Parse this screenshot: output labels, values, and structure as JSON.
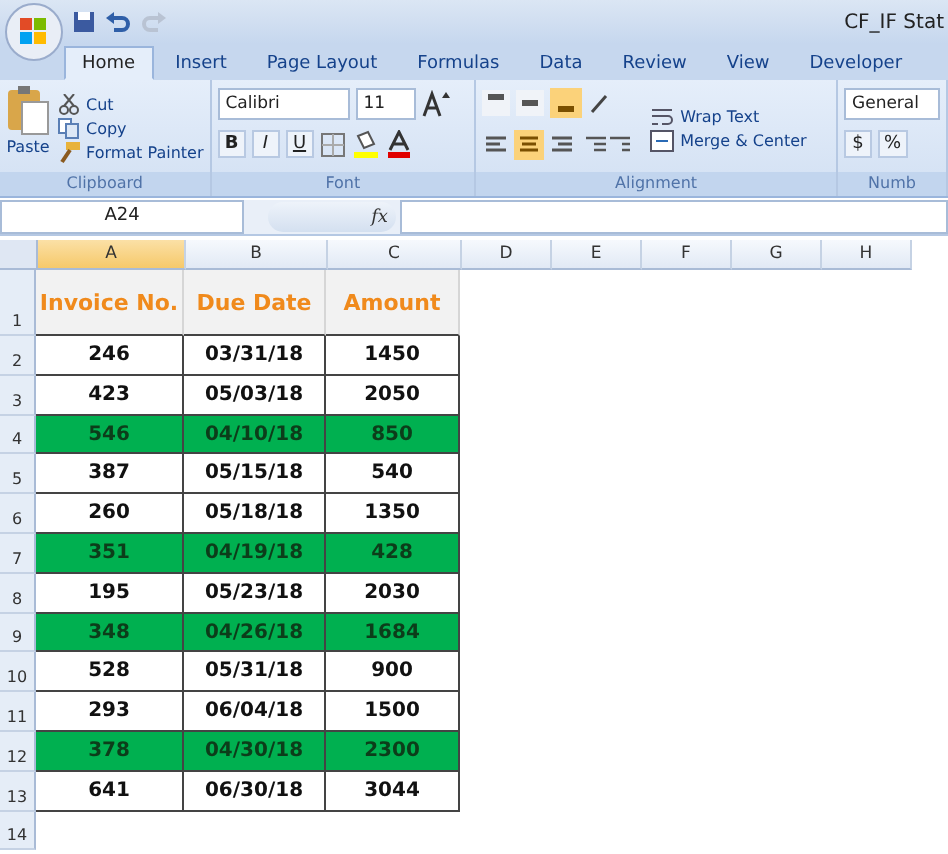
{
  "window": {
    "title": "CF_IF Stat"
  },
  "tabs": [
    {
      "label": "Home",
      "selected": true
    },
    {
      "label": "Insert",
      "selected": false
    },
    {
      "label": "Page Layout",
      "selected": false
    },
    {
      "label": "Formulas",
      "selected": false
    },
    {
      "label": "Data",
      "selected": false
    },
    {
      "label": "Review",
      "selected": false
    },
    {
      "label": "View",
      "selected": false
    },
    {
      "label": "Developer",
      "selected": false
    }
  ],
  "ribbon": {
    "clipboard": {
      "paste": "Paste",
      "cut": "Cut",
      "copy": "Copy",
      "format_painter": "Format Painter",
      "label": "Clipboard"
    },
    "font": {
      "name": "Calibri",
      "size": "11",
      "bold": "B",
      "italic": "I",
      "underline": "U",
      "label": "Font"
    },
    "alignment": {
      "wrap": "Wrap Text",
      "merge": "Merge & Center",
      "label": "Alignment"
    },
    "number": {
      "format": "General",
      "currency": "$",
      "percent": "%",
      "label": "Numb"
    }
  },
  "formula_bar": {
    "name_box": "A24",
    "fx": "fx"
  },
  "columns": [
    {
      "label": "A",
      "selected": true
    },
    {
      "label": "B",
      "selected": false
    },
    {
      "label": "C",
      "selected": false
    },
    {
      "label": "D",
      "selected": false
    },
    {
      "label": "E",
      "selected": false
    },
    {
      "label": "F",
      "selected": false
    },
    {
      "label": "G",
      "selected": false
    },
    {
      "label": "H",
      "selected": false
    }
  ],
  "header_row": {
    "number": "1",
    "cells": [
      "Invoice No.",
      "Due Date",
      "Amount"
    ]
  },
  "rows": [
    {
      "number": "2",
      "cells": [
        "246",
        "03/31/18",
        "1450"
      ],
      "highlighted": false
    },
    {
      "number": "3",
      "cells": [
        "423",
        "05/03/18",
        "2050"
      ],
      "highlighted": false
    },
    {
      "number": "4",
      "cells": [
        "546",
        "04/10/18",
        "850"
      ],
      "highlighted": true
    },
    {
      "number": "5",
      "cells": [
        "387",
        "05/15/18",
        "540"
      ],
      "highlighted": false
    },
    {
      "number": "6",
      "cells": [
        "260",
        "05/18/18",
        "1350"
      ],
      "highlighted": false
    },
    {
      "number": "7",
      "cells": [
        "351",
        "04/19/18",
        "428"
      ],
      "highlighted": true
    },
    {
      "number": "8",
      "cells": [
        "195",
        "05/23/18",
        "2030"
      ],
      "highlighted": false
    },
    {
      "number": "9",
      "cells": [
        "348",
        "04/26/18",
        "1684"
      ],
      "highlighted": true
    },
    {
      "number": "10",
      "cells": [
        "528",
        "05/31/18",
        "900"
      ],
      "highlighted": false
    },
    {
      "number": "11",
      "cells": [
        "293",
        "06/04/18",
        "1500"
      ],
      "highlighted": false
    },
    {
      "number": "12",
      "cells": [
        "378",
        "04/30/18",
        "2300"
      ],
      "highlighted": true
    },
    {
      "number": "13",
      "cells": [
        "641",
        "06/30/18",
        "3044"
      ],
      "highlighted": false
    }
  ],
  "empty_rows": [
    "14"
  ]
}
